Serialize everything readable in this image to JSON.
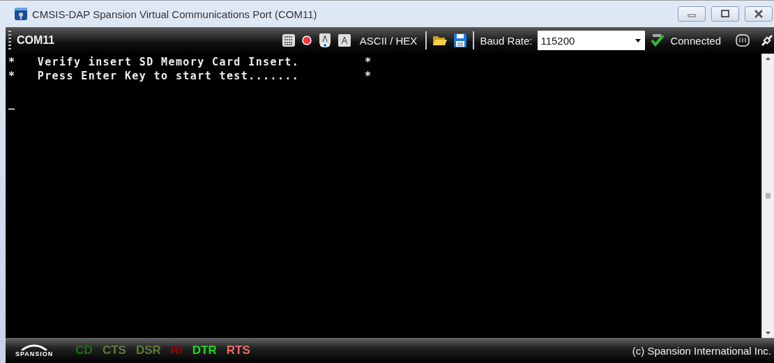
{
  "window": {
    "title": "CMSIS-DAP Spansion Virtual Communications Port (COM11)"
  },
  "toolbar": {
    "port": "COM11",
    "mode_button": "ASCII / HEX",
    "baud_label": "Baud Rate:",
    "baud_value": "115200",
    "status": "Connected"
  },
  "terminal": {
    "lines": [
      "*   Verify insert SD Memory Card Insert.         *",
      "*   Press Enter Key to start test.......         *",
      "_"
    ]
  },
  "status_bar": {
    "logo": "SPANSION",
    "signals": [
      {
        "label": "CD",
        "color": "#1e6e1e"
      },
      {
        "label": "CTS",
        "color": "#5e7a3c"
      },
      {
        "label": "DSR",
        "color": "#5e7a3c"
      },
      {
        "label": "RI",
        "color": "#8b0a0a"
      },
      {
        "label": "DTR",
        "color": "#10e010"
      },
      {
        "label": "RTS",
        "color": "#f06a6a"
      }
    ],
    "copyright": "(c) Spansion International Inc."
  }
}
